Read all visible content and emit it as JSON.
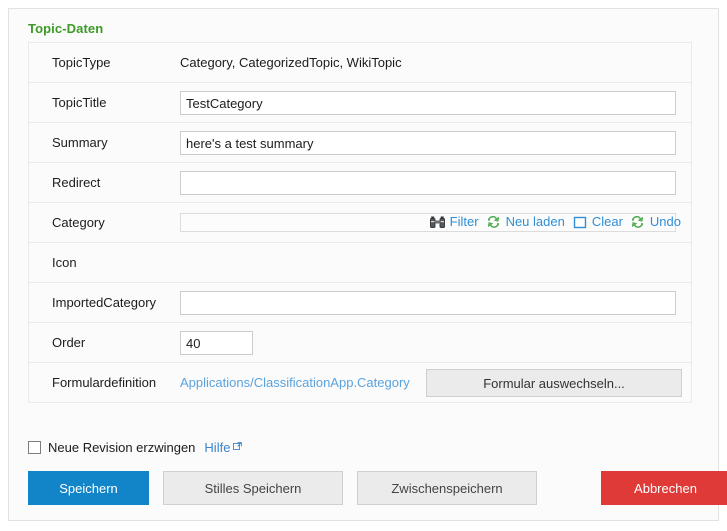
{
  "form": {
    "title": "Topic-Daten",
    "rows": [
      {
        "label": "TopicType",
        "type": "static",
        "value": "Category, CategorizedTopic, WikiTopic"
      },
      {
        "label": "TopicTitle",
        "type": "input",
        "value": "TestCategory",
        "placeholder": ""
      },
      {
        "label": "Summary",
        "type": "input",
        "value": "here's a test summary",
        "placeholder": ""
      },
      {
        "label": "Redirect",
        "type": "input",
        "value": "",
        "placeholder": ""
      },
      {
        "label": "Category",
        "type": "picker",
        "value": ""
      },
      {
        "label": "Icon",
        "type": "empty",
        "value": ""
      },
      {
        "label": "ImportedCategory",
        "type": "input",
        "value": "",
        "placeholder": ""
      },
      {
        "label": "Order",
        "type": "input",
        "value": "40",
        "placeholder": ""
      },
      {
        "label": "Formulardefinition",
        "type": "formdef",
        "value": "Applications/ClassificationApp.Category"
      }
    ]
  },
  "category_toolbar": {
    "filter_label": "Filter",
    "filter_icon": "binoculars-icon",
    "reload_label": "Neu laden",
    "reload_icon": "refresh-icon",
    "clear_label": "Clear",
    "clear_icon": "empty-box-icon",
    "undo_label": "Undo",
    "undo_icon": "refresh-icon"
  },
  "formdef": {
    "link_text": "Applications/ClassificationApp.Category",
    "swap_button_label": "Formular auswechseln..."
  },
  "revision": {
    "checkbox_label": "Neue Revision erzwingen",
    "checked": false,
    "help_label": "Hilfe",
    "help_icon": "external-link-icon"
  },
  "actions": {
    "save_label": "Speichern",
    "silent_save_label": "Stilles Speichern",
    "draft_save_label": "Zwischenspeichern",
    "cancel_label": "Abbrechen"
  },
  "colors": {
    "title_green": "#3d9a27",
    "primary_blue": "#1284c8",
    "danger_red": "#e03a38",
    "link_blue": "#2f8ed6",
    "formdef_link_blue": "#5ba3de"
  }
}
